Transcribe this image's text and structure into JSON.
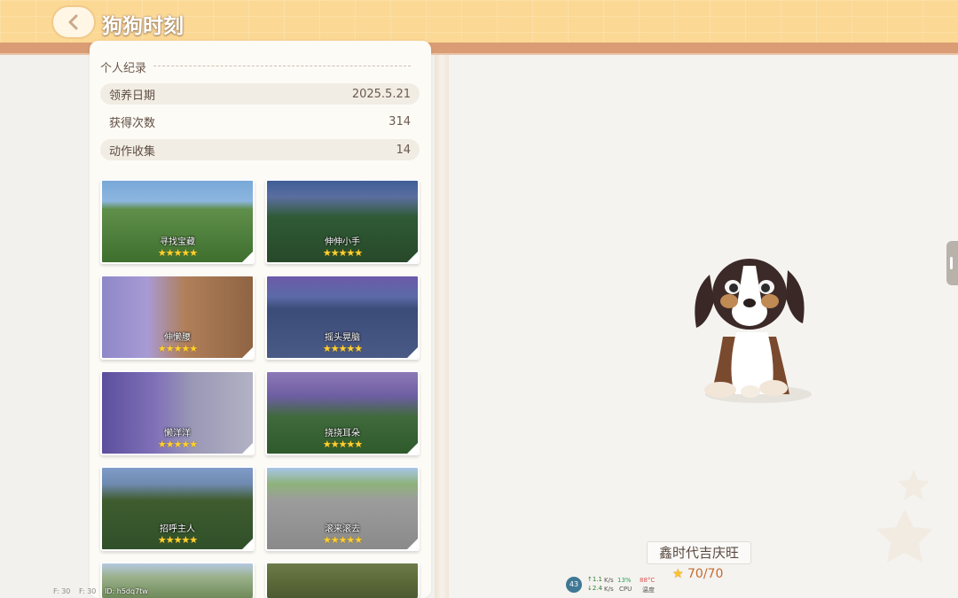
{
  "header": {
    "title": "狗狗时刻"
  },
  "record": {
    "section_title": "个人纪录",
    "stats": [
      {
        "label": "领养日期",
        "value": "2025.5.21"
      },
      {
        "label": "获得次数",
        "value": "314"
      },
      {
        "label": "动作收集",
        "value": "14"
      }
    ]
  },
  "actions": [
    {
      "name": "寻找宝藏",
      "stars": "★★★★★"
    },
    {
      "name": "伸伸小手",
      "stars": "★★★★★"
    },
    {
      "name": "伸懒腰",
      "stars": "★★★★★"
    },
    {
      "name": "摇头晃脑",
      "stars": "★★★★★"
    },
    {
      "name": "懒洋洋",
      "stars": "★★★★★"
    },
    {
      "name": "挠挠耳朵",
      "stars": "★★★★★"
    },
    {
      "name": "招呼主人",
      "stars": "★★★★★"
    },
    {
      "name": "滚来滚去",
      "stars": "★★★★★"
    }
  ],
  "dog": {
    "name": "鑫时代吉庆旺",
    "progress": "70/70"
  },
  "overlay": {
    "fps1": "F: 30",
    "fps2": "F: 30",
    "id": "ID: h5dq7tw",
    "perf_badge": "43",
    "up_speed": "↑1.1",
    "down_speed": "↓2.4",
    "unit1": "K/s",
    "unit2": "K/s",
    "cpu_val": "13%",
    "cpu_label": "CPU",
    "temp_val": "88°C",
    "temp_label": "温度"
  },
  "colors": {
    "header": "#fbd894",
    "accent_band": "#d99c74",
    "star": "#ffd230",
    "progress": "#c46b2e"
  }
}
